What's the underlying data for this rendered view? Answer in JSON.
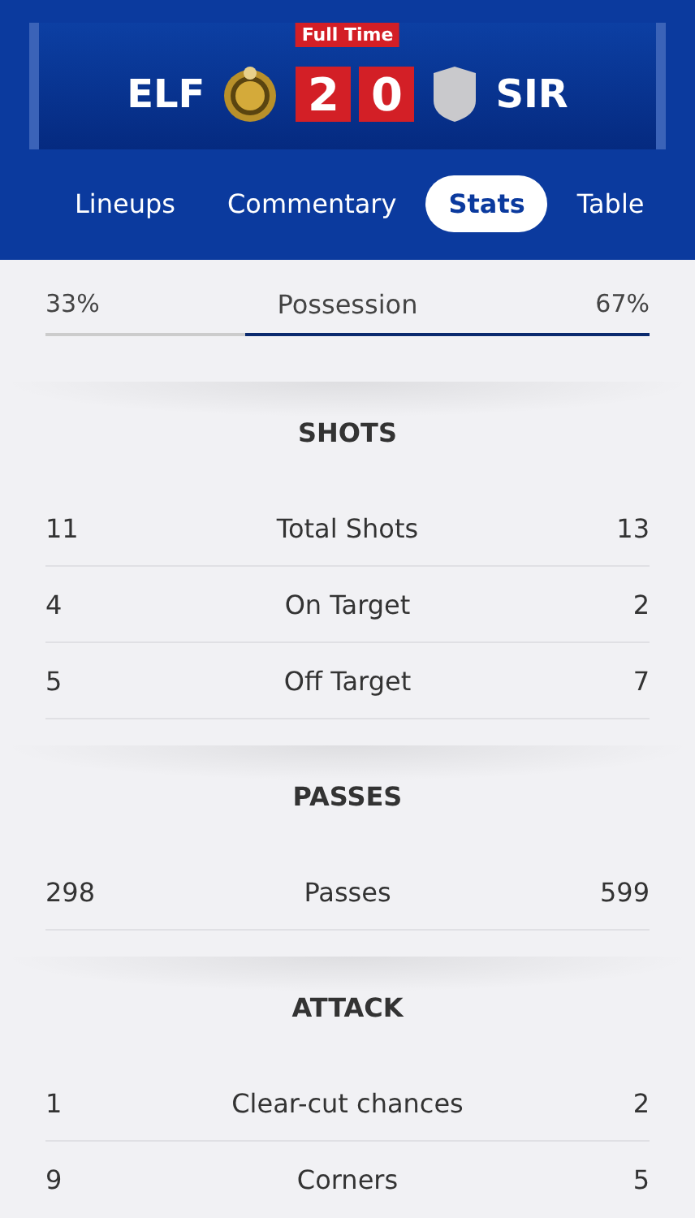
{
  "match": {
    "status": "Full Time",
    "home": {
      "name": "ELF",
      "score": "2"
    },
    "away": {
      "name": "SIR",
      "score": "0"
    }
  },
  "tabs": [
    {
      "label": "Lineups",
      "selected": false
    },
    {
      "label": "Commentary",
      "selected": false
    },
    {
      "label": "Stats",
      "selected": true
    },
    {
      "label": "Table",
      "selected": false
    }
  ],
  "possession": {
    "home": "33%",
    "label": "Possession",
    "away": "67%",
    "level": 0.67
  },
  "sections": [
    {
      "title": "SHOTS",
      "rows": [
        {
          "home": "11",
          "label": "Total Shots",
          "away": "13"
        },
        {
          "home": "4",
          "label": "On Target",
          "away": "2"
        },
        {
          "home": "5",
          "label": "Off Target",
          "away": "7"
        }
      ]
    },
    {
      "title": "PASSES",
      "rows": [
        {
          "home": "298",
          "label": "Passes",
          "away": "599"
        }
      ]
    },
    {
      "title": "ATTACK",
      "rows": [
        {
          "home": "1",
          "label": "Clear-cut chances",
          "away": "2"
        },
        {
          "home": "9",
          "label": "Corners",
          "away": "5"
        }
      ]
    }
  ]
}
